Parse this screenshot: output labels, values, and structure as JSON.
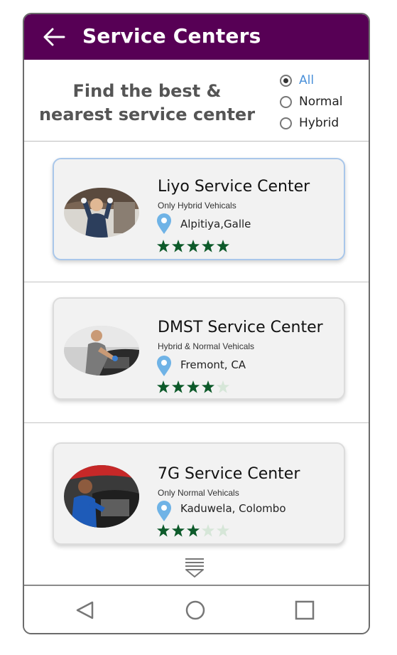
{
  "appbar": {
    "title": "Service Centers",
    "back_icon": "arrow-left-icon",
    "color": "#570055"
  },
  "header": {
    "tagline": "Find the best & nearest service center"
  },
  "filter": {
    "options": [
      "All",
      "Normal",
      "Hybrid"
    ],
    "selected": "All"
  },
  "centers": [
    {
      "name": "Liyo Service Center",
      "type": "Only Hybrid Vehicals",
      "location": "Alpitiya,Galle",
      "rating": 5,
      "max_rating": 5
    },
    {
      "name": "DMST Service Center",
      "type": "Hybrid & Normal Vehicals",
      "location": "Fremont, CA",
      "rating": 4,
      "max_rating": 5
    },
    {
      "name": "7G Service Center",
      "type": "Only Normal Vehicals",
      "location": "Kaduwela, Colombo",
      "rating": 3,
      "max_rating": 5
    }
  ],
  "more_icon": "expand-down-icon",
  "navbar": {
    "icons": [
      "back-triangle-icon",
      "home-circle-icon",
      "recents-square-icon"
    ]
  },
  "colors": {
    "star_filled": "#0d5a2a",
    "star_empty": "#d6e6d8",
    "pin": "#6fb3e6",
    "accent": "#4a90d9"
  }
}
